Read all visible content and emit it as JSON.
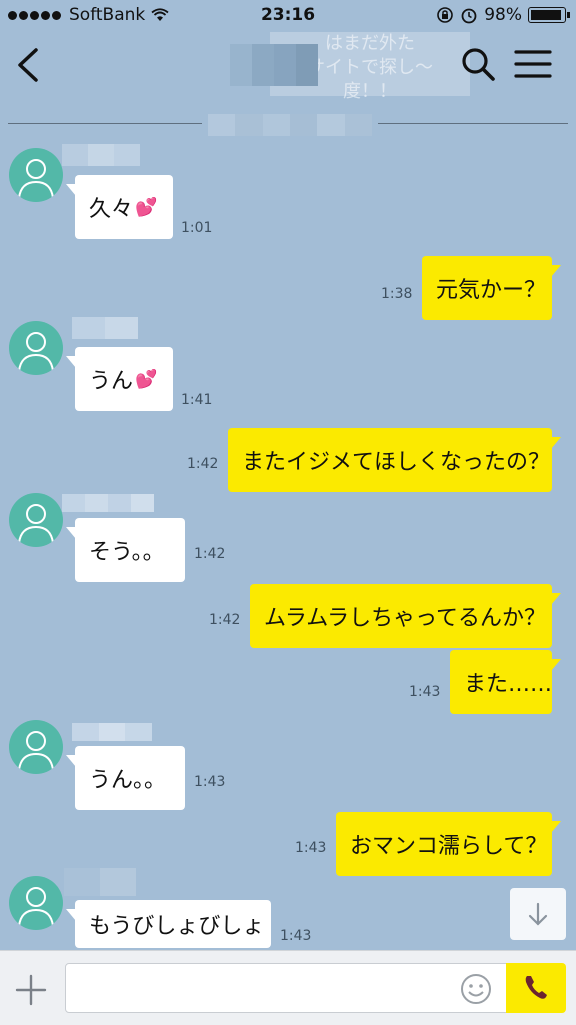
{
  "status_bar": {
    "carrier": "SoftBank",
    "time": "23:16",
    "battery": "98%"
  },
  "header": {
    "background_ad_text": "はまだ外た\nサイトで探し〜\n度！！"
  },
  "messages": [
    {
      "side": "in",
      "text": "久々",
      "emoji": "heart",
      "time": "1:01"
    },
    {
      "side": "out",
      "text": "元気かー？",
      "time": "1:38"
    },
    {
      "side": "in",
      "text": "うん",
      "emoji": "heart",
      "time": "1:41"
    },
    {
      "side": "out",
      "text": "またイジメてほしくなったの？",
      "time": "1:42"
    },
    {
      "side": "in",
      "text": "そう。。",
      "time": "1:42"
    },
    {
      "side": "out",
      "text": "ムラムラしちゃってるんか？",
      "time": "1:42"
    },
    {
      "side": "out",
      "text": "また……",
      "time": "1:43"
    },
    {
      "side": "in",
      "text": "うん。。",
      "time": "1:43"
    },
    {
      "side": "out",
      "text": "おマンコ濡らして？",
      "time": "1:43"
    },
    {
      "side": "in",
      "text": "もうびしょびしょ",
      "time": "1:43"
    }
  ],
  "input": {
    "placeholder": ""
  },
  "colors": {
    "background": "#a3bdd6",
    "outgoing_bubble": "#fbea00",
    "incoming_bubble": "#ffffff",
    "avatar": "#53b8a8"
  },
  "icons": [
    "back-icon",
    "search-icon",
    "menu-icon",
    "avatar-icon",
    "heart-icon",
    "arrow-down-icon",
    "plus-icon",
    "emoji-icon",
    "phone-icon"
  ]
}
